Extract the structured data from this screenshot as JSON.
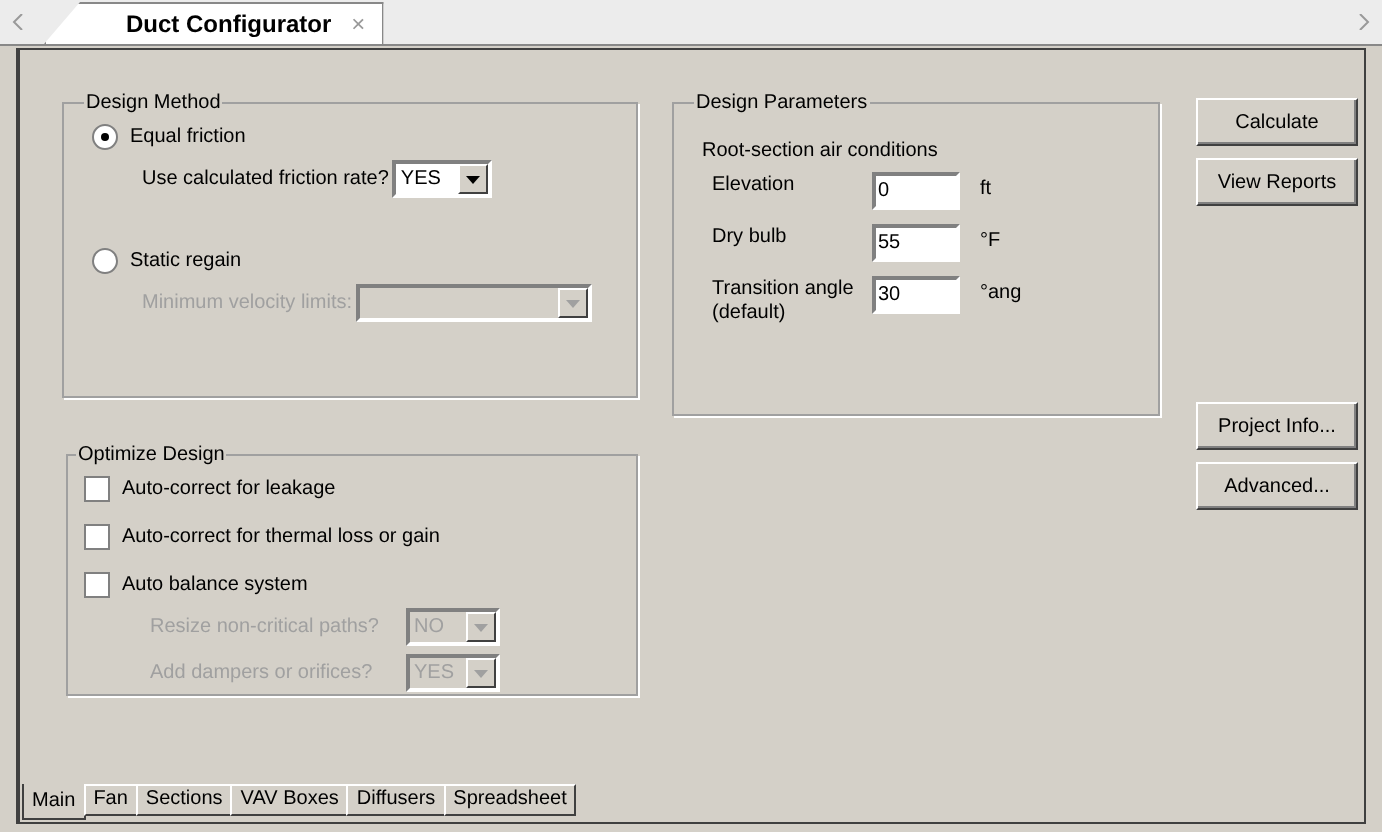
{
  "document_tab": {
    "title": "Duct Configurator",
    "close": "×"
  },
  "design_method": {
    "title": "Design Method",
    "options": [
      {
        "label": "Equal friction",
        "selected": true,
        "field": {
          "label": "Use calculated friction rate?",
          "value": "YES",
          "disabled": false
        }
      },
      {
        "label": "Static regain",
        "selected": false,
        "field": {
          "label": "Minimum velocity limits:",
          "disabled": true
        }
      }
    ]
  },
  "design_parameters": {
    "title": "Design Parameters",
    "subtitle": "Root-section air conditions",
    "fields": [
      {
        "label": "Elevation",
        "value": "0",
        "unit": "ft"
      },
      {
        "label": "Dry bulb",
        "value": "55",
        "unit": "°F"
      },
      {
        "label": "Transition angle",
        "note": "(default)",
        "value": "30",
        "unit": "°ang"
      }
    ]
  },
  "buttons_top": [
    "Calculate",
    "View Reports"
  ],
  "buttons_bottom": [
    "Project Info...",
    "Advanced..."
  ],
  "optimize_design": {
    "title": "Optimize Design",
    "checkboxes": [
      {
        "label": "Auto-correct for leakage",
        "checked": false
      },
      {
        "label": "Auto-correct for thermal loss or gain",
        "checked": false
      },
      {
        "label": "Auto balance system",
        "checked": false
      }
    ],
    "sub_fields": [
      {
        "label": "Resize non-critical paths?",
        "value": "NO",
        "disabled": true
      },
      {
        "label": "Add dampers or orifices?",
        "value": "YES",
        "disabled": true
      }
    ]
  },
  "tabs": [
    {
      "label": "Main",
      "selected": true
    },
    {
      "label": "Fan",
      "selected": false
    },
    {
      "label": "Sections",
      "selected": false
    },
    {
      "label": "VAV Boxes",
      "selected": false
    },
    {
      "label": "Diffusers",
      "selected": false
    },
    {
      "label": "Spreadsheet",
      "selected": false
    }
  ]
}
